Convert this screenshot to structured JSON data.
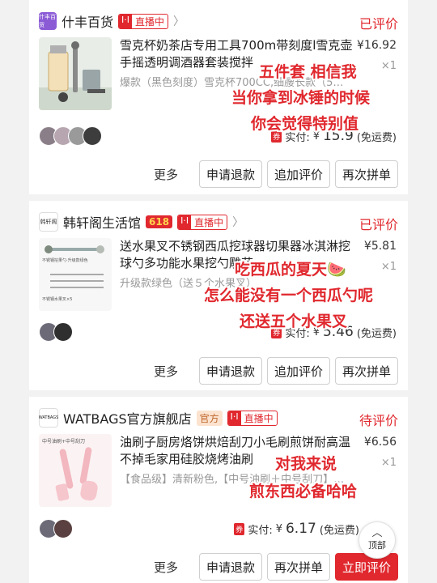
{
  "orders": [
    {
      "shop_logo_text": "什丰百货",
      "shop_name": "什丰百货",
      "live_label": "直播中",
      "live_icon": "I·I",
      "status": "已评价",
      "title": "雪克杯奶茶店专用工具700m带刻度l雪克壶手摇透明调酒器套装搅拌",
      "sku": "爆款（黑色刻度）雪克杯700CC,细腰长款（5…",
      "price": "¥16.92",
      "qty": "×1",
      "coupon_tag": "券",
      "paid_label": "实付:",
      "paid_currency": "¥",
      "paid_amount": "15.9",
      "paid_note": "(免运费)",
      "more": "更多",
      "buttons": [
        "申请退款",
        "追加评价",
        "再次拼单"
      ]
    },
    {
      "shop_logo_text": "韩轩阁",
      "shop_name": "韩轩阁生活馆",
      "promo_badge": "618",
      "live_label": "直播中",
      "live_icon": "I·I",
      "status": "已评价",
      "title": "送水果叉不锈钢西瓜挖球器切果器冰淇淋挖球勺多功能水果挖勺雕花",
      "sku": "升级款绿色（送５个水果叉）",
      "price": "¥5.81",
      "qty": "×1",
      "coupon_tag": "券",
      "paid_label": "实付:",
      "paid_currency": "¥",
      "paid_amount": "5.46",
      "paid_note": "(免运费)",
      "more": "更多",
      "buttons": [
        "申请退款",
        "追加评价",
        "再次拼单"
      ]
    },
    {
      "shop_logo_text": "WATBAGS",
      "shop_name": "WATBAGS官方旗舰店",
      "official_badge": "官方",
      "live_label": "直播中",
      "live_icon": "I·I",
      "status": "待评价",
      "title": "油刷子厨房烙饼烘焙刮刀小毛刷煎饼耐高温不掉毛家用硅胶烧烤油刷",
      "sku": "【食品级】清新粉色,【中号油刷＋中号刮刀】…",
      "price": "¥6.56",
      "qty": "×1",
      "coupon_tag": "券",
      "paid_label": "实付:",
      "paid_currency": "¥",
      "paid_amount": "6.17",
      "paid_note": "(免运费)",
      "more": "更多",
      "buttons": [
        "申请退款",
        "再次拼单",
        "立即评价"
      ]
    }
  ],
  "overlay_texts": {
    "o1_line1": "五件套 相信我",
    "o1_line2": "当你拿到冰锤的时候",
    "o1_line3": "你会觉得特别值",
    "o2_line1": "吃西瓜的夏天🍉",
    "o2_line2": "怎么能没有一个西瓜勺呢",
    "o2_line3": "还送五个水果叉",
    "o3_line1": "对我来说",
    "o3_line2": "煎东西必备哈哈"
  },
  "thumb_labels": {
    "t2_top": "不锈钢挖果勺·升级款绿色",
    "t2_bottom": "不锈钢水果叉×5",
    "t3_top": "中号油刷+中号刮刀"
  },
  "back_to_top": "顶部",
  "colors": {
    "accent": "#e0282e",
    "muted": "#999999"
  }
}
